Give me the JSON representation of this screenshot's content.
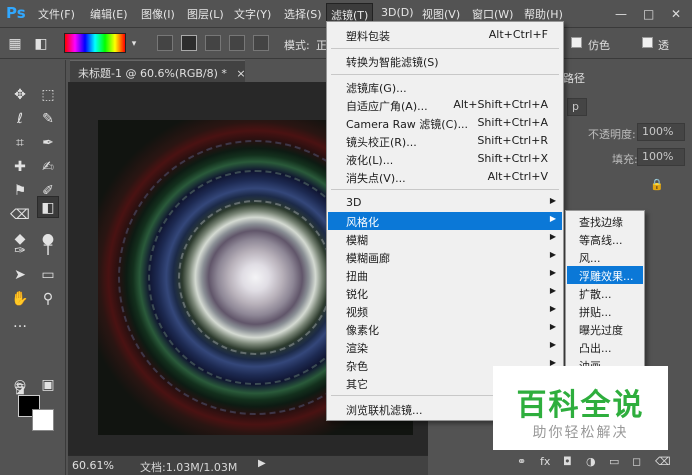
{
  "menubar": {
    "logo": "Ps",
    "items": [
      "文件(F)",
      "编辑(E)",
      "图像(I)",
      "图层(L)",
      "文字(Y)",
      "选择(S)",
      "滤镜(T)",
      "3D(D)",
      "视图(V)",
      "窗口(W)",
      "帮助(H)"
    ],
    "window_controls": [
      "—",
      "□",
      "✕"
    ]
  },
  "options": {
    "mode_label": "模式:",
    "mode_value": "正",
    "fake_label": "仿色",
    "transparency_label": "透"
  },
  "document": {
    "tab_title": "未标题-1 @ 60.6%(RGB/8) *",
    "tab_close": "×",
    "zoom": "60.61%",
    "doc_info": "文档:1.03M/1.03M",
    "status_arrow": "▶"
  },
  "layers_panel": {
    "tab": "路径",
    "opacity_label": "不透明度:",
    "opacity_value": "100%",
    "fill_label": "填充:",
    "fill_value": "100%",
    "kind_value": "p"
  },
  "filter_menu": {
    "items": [
      {
        "label": "塑料包装",
        "shortcut": "Alt+Ctrl+F"
      },
      {
        "label": "转换为智能滤镜(S)",
        "shortcut": ""
      },
      {
        "label": "滤镜库(G)...",
        "shortcut": ""
      },
      {
        "label": "自适应广角(A)...",
        "shortcut": "Alt+Shift+Ctrl+A"
      },
      {
        "label": "Camera Raw 滤镜(C)...",
        "shortcut": "Shift+Ctrl+A"
      },
      {
        "label": "镜头校正(R)...",
        "shortcut": "Shift+Ctrl+R"
      },
      {
        "label": "液化(L)...",
        "shortcut": "Shift+Ctrl+X"
      },
      {
        "label": "消失点(V)...",
        "shortcut": "Alt+Ctrl+V"
      },
      {
        "label": "3D",
        "shortcut": ""
      },
      {
        "label": "风格化",
        "shortcut": ""
      },
      {
        "label": "模糊",
        "shortcut": ""
      },
      {
        "label": "模糊画廊",
        "shortcut": ""
      },
      {
        "label": "扭曲",
        "shortcut": ""
      },
      {
        "label": "锐化",
        "shortcut": ""
      },
      {
        "label": "视频",
        "shortcut": ""
      },
      {
        "label": "像素化",
        "shortcut": ""
      },
      {
        "label": "渲染",
        "shortcut": ""
      },
      {
        "label": "杂色",
        "shortcut": ""
      },
      {
        "label": "其它",
        "shortcut": ""
      },
      {
        "label": "浏览联机滤镜...",
        "shortcut": ""
      }
    ]
  },
  "stylize_submenu": {
    "items": [
      "查找边缘",
      "等高线...",
      "风...",
      "浮雕效果...",
      "扩散...",
      "拼贴...",
      "曝光过度",
      "凸出...",
      "油画..."
    ]
  },
  "watermark": {
    "title": "百科全说",
    "subtitle": "助你轻松解决"
  }
}
